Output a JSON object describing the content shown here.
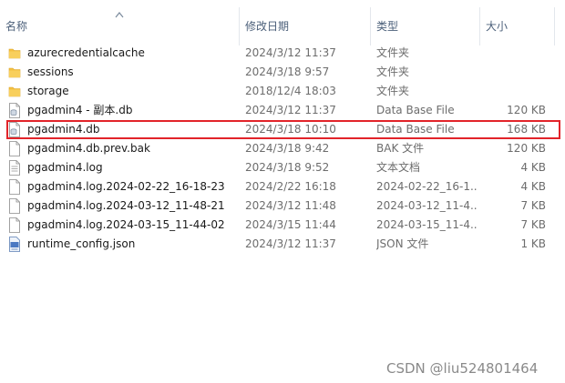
{
  "columns": {
    "name": "名称",
    "date": "修改日期",
    "type": "类型",
    "size": "大小"
  },
  "files": [
    {
      "icon": "folder-icon",
      "name": "azurecredentialcache",
      "date": "2024/3/12 11:37",
      "type": "文件夹",
      "size": ""
    },
    {
      "icon": "folder-icon",
      "name": "sessions",
      "date": "2024/3/18 9:57",
      "type": "文件夹",
      "size": ""
    },
    {
      "icon": "folder-icon",
      "name": "storage",
      "date": "2018/12/4 18:03",
      "type": "文件夹",
      "size": ""
    },
    {
      "icon": "database-file-icon",
      "name": "pgadmin4 - 副本.db",
      "date": "2024/3/12 11:37",
      "type": "Data Base File",
      "size": "120 KB"
    },
    {
      "icon": "database-file-icon",
      "name": "pgadmin4.db",
      "date": "2024/3/18 10:10",
      "type": "Data Base File",
      "size": "168 KB"
    },
    {
      "icon": "blank-file-icon",
      "name": "pgadmin4.db.prev.bak",
      "date": "2024/3/18 9:42",
      "type": "BAK 文件",
      "size": "120 KB"
    },
    {
      "icon": "text-file-icon",
      "name": "pgadmin4.log",
      "date": "2024/3/18 9:52",
      "type": "文本文档",
      "size": "4 KB"
    },
    {
      "icon": "blank-file-icon",
      "name": "pgadmin4.log.2024-02-22_16-18-23",
      "date": "2024/2/22 16:18",
      "type": "2024-02-22_16-1...",
      "size": "4 KB"
    },
    {
      "icon": "blank-file-icon",
      "name": "pgadmin4.log.2024-03-12_11-48-21",
      "date": "2024/3/12 11:48",
      "type": "2024-03-12_11-4...",
      "size": "7 KB"
    },
    {
      "icon": "blank-file-icon",
      "name": "pgadmin4.log.2024-03-15_11-44-02",
      "date": "2024/3/15 11:44",
      "type": "2024-03-15_11-4...",
      "size": "7 KB"
    },
    {
      "icon": "json-file-icon",
      "name": "runtime_config.json",
      "date": "2024/3/12 11:37",
      "type": "JSON 文件",
      "size": "1 KB"
    }
  ],
  "highlight_color": "#e2242a",
  "folder_color": "#f5c042",
  "watermark": "CSDN @liu524801464"
}
